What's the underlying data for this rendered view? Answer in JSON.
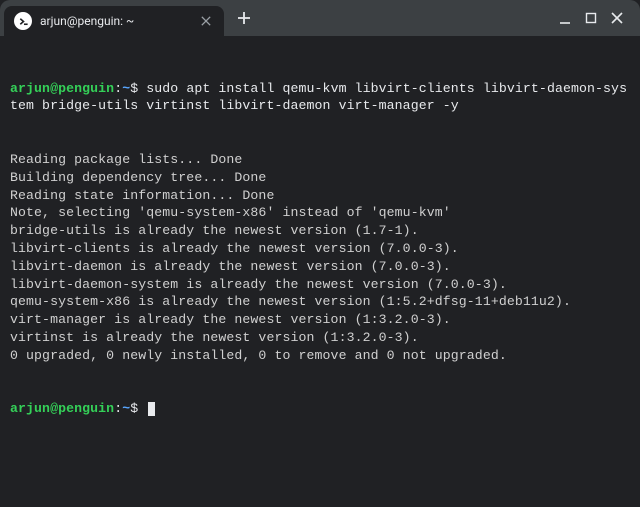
{
  "window": {
    "tab_title": "arjun@penguin: ~"
  },
  "prompt": {
    "user_host": "arjun@penguin",
    "colon": ":",
    "path": "~",
    "symbol": "$"
  },
  "command": "sudo apt install qemu-kvm libvirt-clients libvirt-daemon-system bridge-utils virtinst libvirt-daemon virt-manager -y",
  "output": [
    "Reading package lists... Done",
    "Building dependency tree... Done",
    "Reading state information... Done",
    "Note, selecting 'qemu-system-x86' instead of 'qemu-kvm'",
    "bridge-utils is already the newest version (1.7-1).",
    "libvirt-clients is already the newest version (7.0.0-3).",
    "libvirt-daemon is already the newest version (7.0.0-3).",
    "libvirt-daemon-system is already the newest version (7.0.0-3).",
    "qemu-system-x86 is already the newest version (1:5.2+dfsg-11+deb11u2).",
    "virt-manager is already the newest version (1:3.2.0-3).",
    "virtinst is already the newest version (1:3.2.0-3).",
    "0 upgraded, 0 newly installed, 0 to remove and 0 not upgraded."
  ]
}
